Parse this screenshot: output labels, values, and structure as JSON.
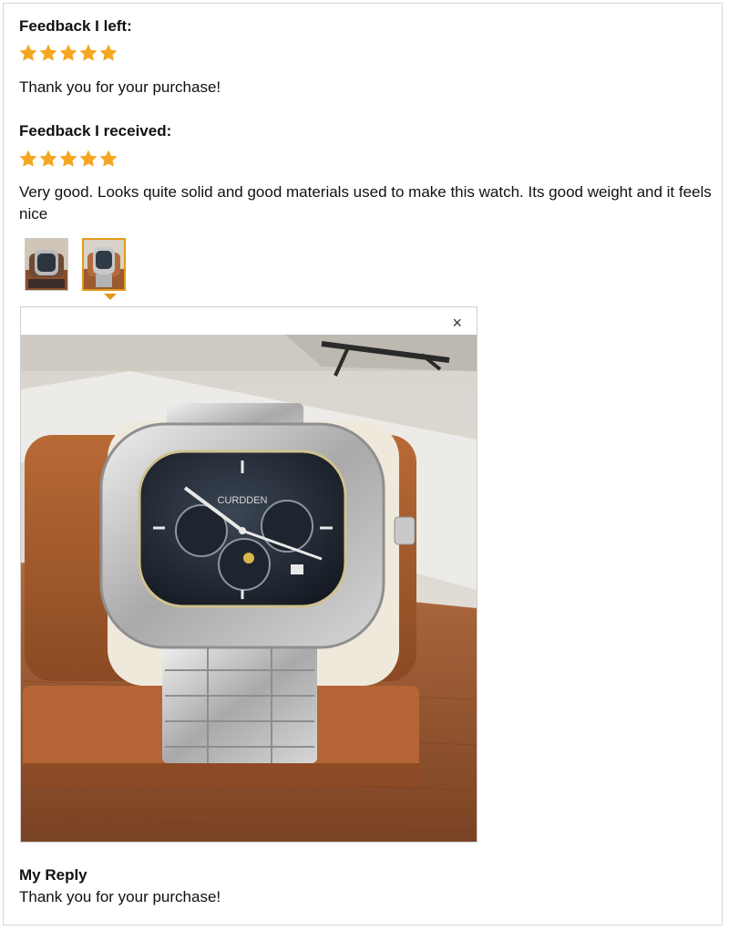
{
  "feedback_left": {
    "heading": "Feedback I left:",
    "rating": 5,
    "text": "Thank you for your purchase!"
  },
  "feedback_received": {
    "heading": "Feedback I received:",
    "rating": 5,
    "text": "Very good. Looks quite solid and good materials used to make this watch. Its good weight and it feels nice"
  },
  "gallery": {
    "thumbnails": [
      {
        "icon": "watch-photo-thumbnail",
        "selected": false
      },
      {
        "icon": "watch-photo-thumbnail",
        "selected": true
      }
    ],
    "close_symbol": "×",
    "watch_brand": "CURDDEN"
  },
  "reply": {
    "heading": "My Reply",
    "text": "Thank you for your purchase!"
  },
  "colors": {
    "star": "#f5a623",
    "selected_border": "#e09b1a"
  }
}
